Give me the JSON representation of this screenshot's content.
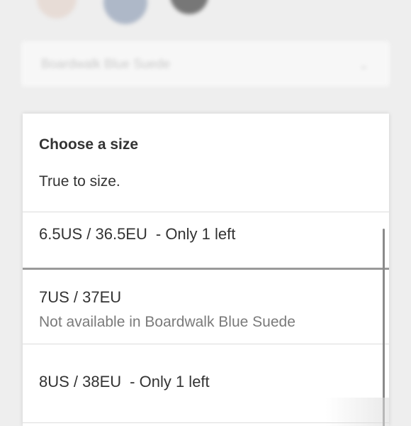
{
  "background": {
    "selected_color": "Boardwalk Blue Suede",
    "swatch_colors": [
      "#e7dcd6",
      "#aeb8c8",
      "#777777"
    ]
  },
  "size_dropdown": {
    "title": "Choose a size",
    "subtitle": "True to size.",
    "options": [
      {
        "size": "6.5US / 36.5EU",
        "stock": "- Only 1 left",
        "note": ""
      },
      {
        "size": "7US / 37EU",
        "stock": "",
        "note": "Not available in Boardwalk Blue Suede"
      },
      {
        "size": "8US / 38EU",
        "stock": "- Only 1 left",
        "note": ""
      }
    ]
  }
}
